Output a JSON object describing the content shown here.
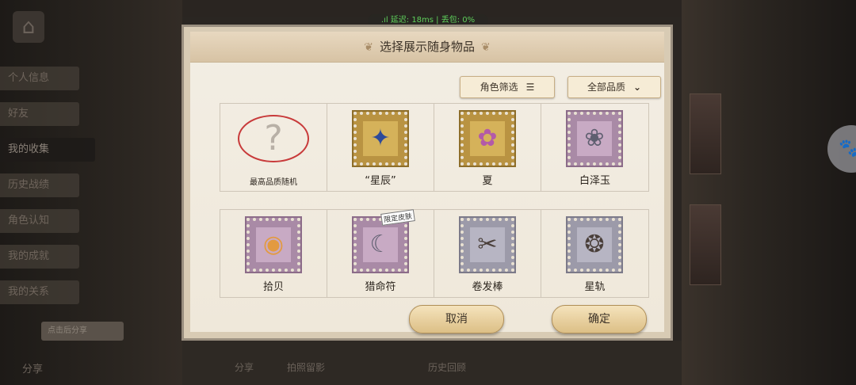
{
  "status": {
    "network": ".ıl 延迟: 18ms | 丢包: 0%"
  },
  "sidebar": {
    "items": [
      {
        "label": "个人信息"
      },
      {
        "label": "好友"
      },
      {
        "label": "我的收集"
      },
      {
        "label": "历史战绩"
      },
      {
        "label": "角色认知"
      },
      {
        "label": "我的成就"
      },
      {
        "label": "我的关系"
      }
    ],
    "share_bubble": "点击后分享",
    "share_label": "分享"
  },
  "dialog": {
    "title": "选择展示随身物品",
    "filters": {
      "role_filter": "角色筛选",
      "quality_filter": "全部品质"
    },
    "items_row1": [
      {
        "label": "最高品质随机",
        "icon": "question-mark-icon"
      },
      {
        "label": "“星辰”",
        "icon": "star-bottle-icon",
        "quality": "gold"
      },
      {
        "label": "夏",
        "icon": "flower-bottle-icon",
        "quality": "gold"
      },
      {
        "label": "白泽玉",
        "icon": "jade-pendant-icon",
        "quality": "purple"
      }
    ],
    "items_row2": [
      {
        "label": "拾贝",
        "icon": "pearl-shell-icon",
        "quality": "purple"
      },
      {
        "label": "猎命符",
        "icon": "talisman-icon",
        "quality": "purple",
        "badge": "限定皮肤"
      },
      {
        "label": "卷发棒",
        "icon": "curling-iron-icon",
        "quality": "grey"
      },
      {
        "label": "星轨",
        "icon": "star-orbit-icon",
        "quality": "grey"
      }
    ],
    "cancel": "取消",
    "confirm": "确定"
  },
  "background": {
    "bottom_labels": [
      "分享",
      "拍照留影",
      "历史回顾"
    ]
  }
}
